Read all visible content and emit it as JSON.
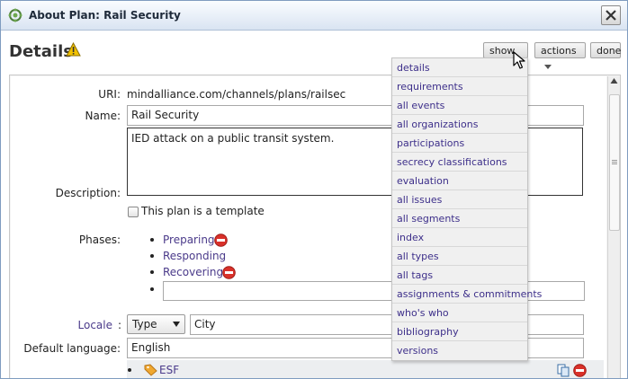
{
  "window": {
    "title": "About Plan: Rail Security"
  },
  "header": {
    "title": "Details",
    "show_label": "show",
    "actions_label": "actions",
    "done_label": "done"
  },
  "form": {
    "uri_label": "URI:",
    "uri_value": "mindalliance.com/channels/plans/railsec",
    "name_label": "Name:",
    "name_value": "Rail Security",
    "description_label": "Description:",
    "description_value": "IED attack on a public transit system.",
    "template_label": "This plan is a template",
    "phases_label": "Phases:",
    "phases": [
      "Preparing",
      "Responding",
      "Recovering"
    ],
    "locale_label": "Locale",
    "locale_sep": ":",
    "locale_type": "Type",
    "locale_value": "City",
    "language_label": "Default language:",
    "language_value": "English",
    "org_tag": "ESF"
  },
  "dropdown": {
    "items": [
      "details",
      "requirements",
      "all events",
      "all organizations",
      "participations",
      "secrecy classifications",
      "evaluation",
      "all issues",
      "all segments",
      "index",
      "all types",
      "all tags",
      "assignments & commitments",
      "who's who",
      "bibliography",
      "versions"
    ]
  },
  "colors": {
    "link": "#4a3a8a",
    "menu_text": "#3d2f8a",
    "remove": "#d9312a",
    "warning": "#f2c200"
  }
}
